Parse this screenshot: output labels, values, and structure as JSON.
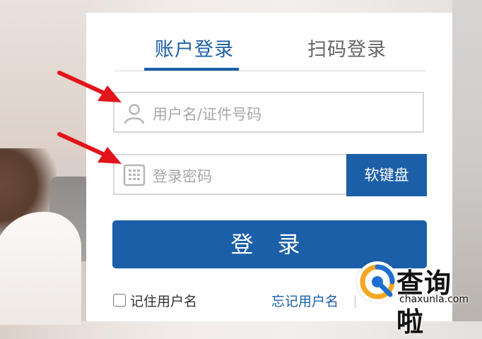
{
  "tabs": {
    "account_login": "账户登录",
    "qr_login": "扫码登录"
  },
  "form": {
    "username_placeholder": "用户名/证件号码",
    "password_placeholder": "登录密码",
    "soft_keyboard": "软键盘",
    "login_button": "登 录",
    "remember_username": "记住用户名",
    "forgot_username": "忘记用户名"
  },
  "watermark": {
    "name": "查询啦",
    "url": "chaxunla.com"
  },
  "colors": {
    "accent": "#1b5fa8",
    "arrow": "#e3141b",
    "watermark_orange": "#f5a623",
    "watermark_blue": "#1f6fd1"
  }
}
